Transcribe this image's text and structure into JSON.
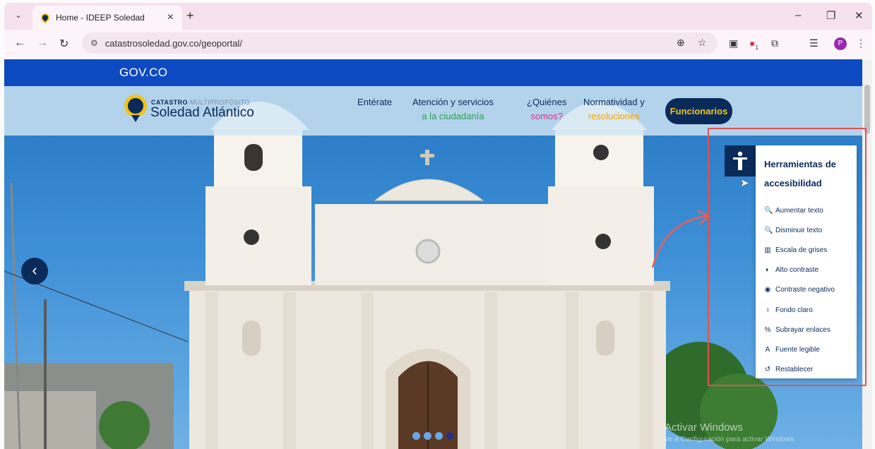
{
  "browser": {
    "tab_title": "Home - IDEEP Soledad",
    "url": "catastrosoledad.gov.co/geoportal/",
    "profile_initial": "P",
    "tab_close": "×",
    "new_tab": "+",
    "extension_badge": "1"
  },
  "gov_bar": {
    "label": "GOV.CO"
  },
  "site": {
    "brand_small_bold": "CATASTRO",
    "brand_small_light": "MULTIPROPÓSITO",
    "brand": "Soledad Atlántico",
    "menu": [
      {
        "line1": "Entérate",
        "line2": "",
        "accent": ""
      },
      {
        "line1": "Atención y servicios",
        "line2": "a la ciudadanía",
        "accent": "#2e9e4f"
      },
      {
        "line1": "¿Quiénes",
        "line2": "somos?",
        "accent": "#d6338a"
      },
      {
        "line1": "Normatividad y",
        "line2": "resoluciones",
        "accent": "#f2a400"
      }
    ],
    "cta": "Funcionarios"
  },
  "carousel": {
    "active_dot": 4,
    "dots": 4
  },
  "accessibility": {
    "title": "Herramientas de accesibilidad",
    "options": [
      {
        "icon": "zoom-in-icon",
        "glyph": "🔍",
        "label": "Aumentar texto"
      },
      {
        "icon": "zoom-out-icon",
        "glyph": "🔍",
        "label": "Disminuir texto"
      },
      {
        "icon": "barcode-icon",
        "glyph": "▥",
        "label": "Escala de grises"
      },
      {
        "icon": "contrast-icon",
        "glyph": "◐",
        "label": "Alto contraste"
      },
      {
        "icon": "eye-icon",
        "glyph": "◉",
        "label": "Contraste negativo"
      },
      {
        "icon": "lightbulb-icon",
        "glyph": "♀",
        "label": "Fondo claro"
      },
      {
        "icon": "link-icon",
        "glyph": "%",
        "label": "Subrayar enlaces"
      },
      {
        "icon": "font-icon",
        "glyph": "A",
        "label": "Fuente legible"
      },
      {
        "icon": "reset-icon",
        "glyph": "↺",
        "label": "Restablecer"
      }
    ]
  },
  "watermark": {
    "line1": "Activar Windows",
    "line2": "Ve a Configuración para activar Windows."
  },
  "colors": {
    "navy": "#0a2b5a",
    "gov_blue": "#0d4ac2",
    "highlight": "#e0524f",
    "cta_text": "#f2c418"
  }
}
